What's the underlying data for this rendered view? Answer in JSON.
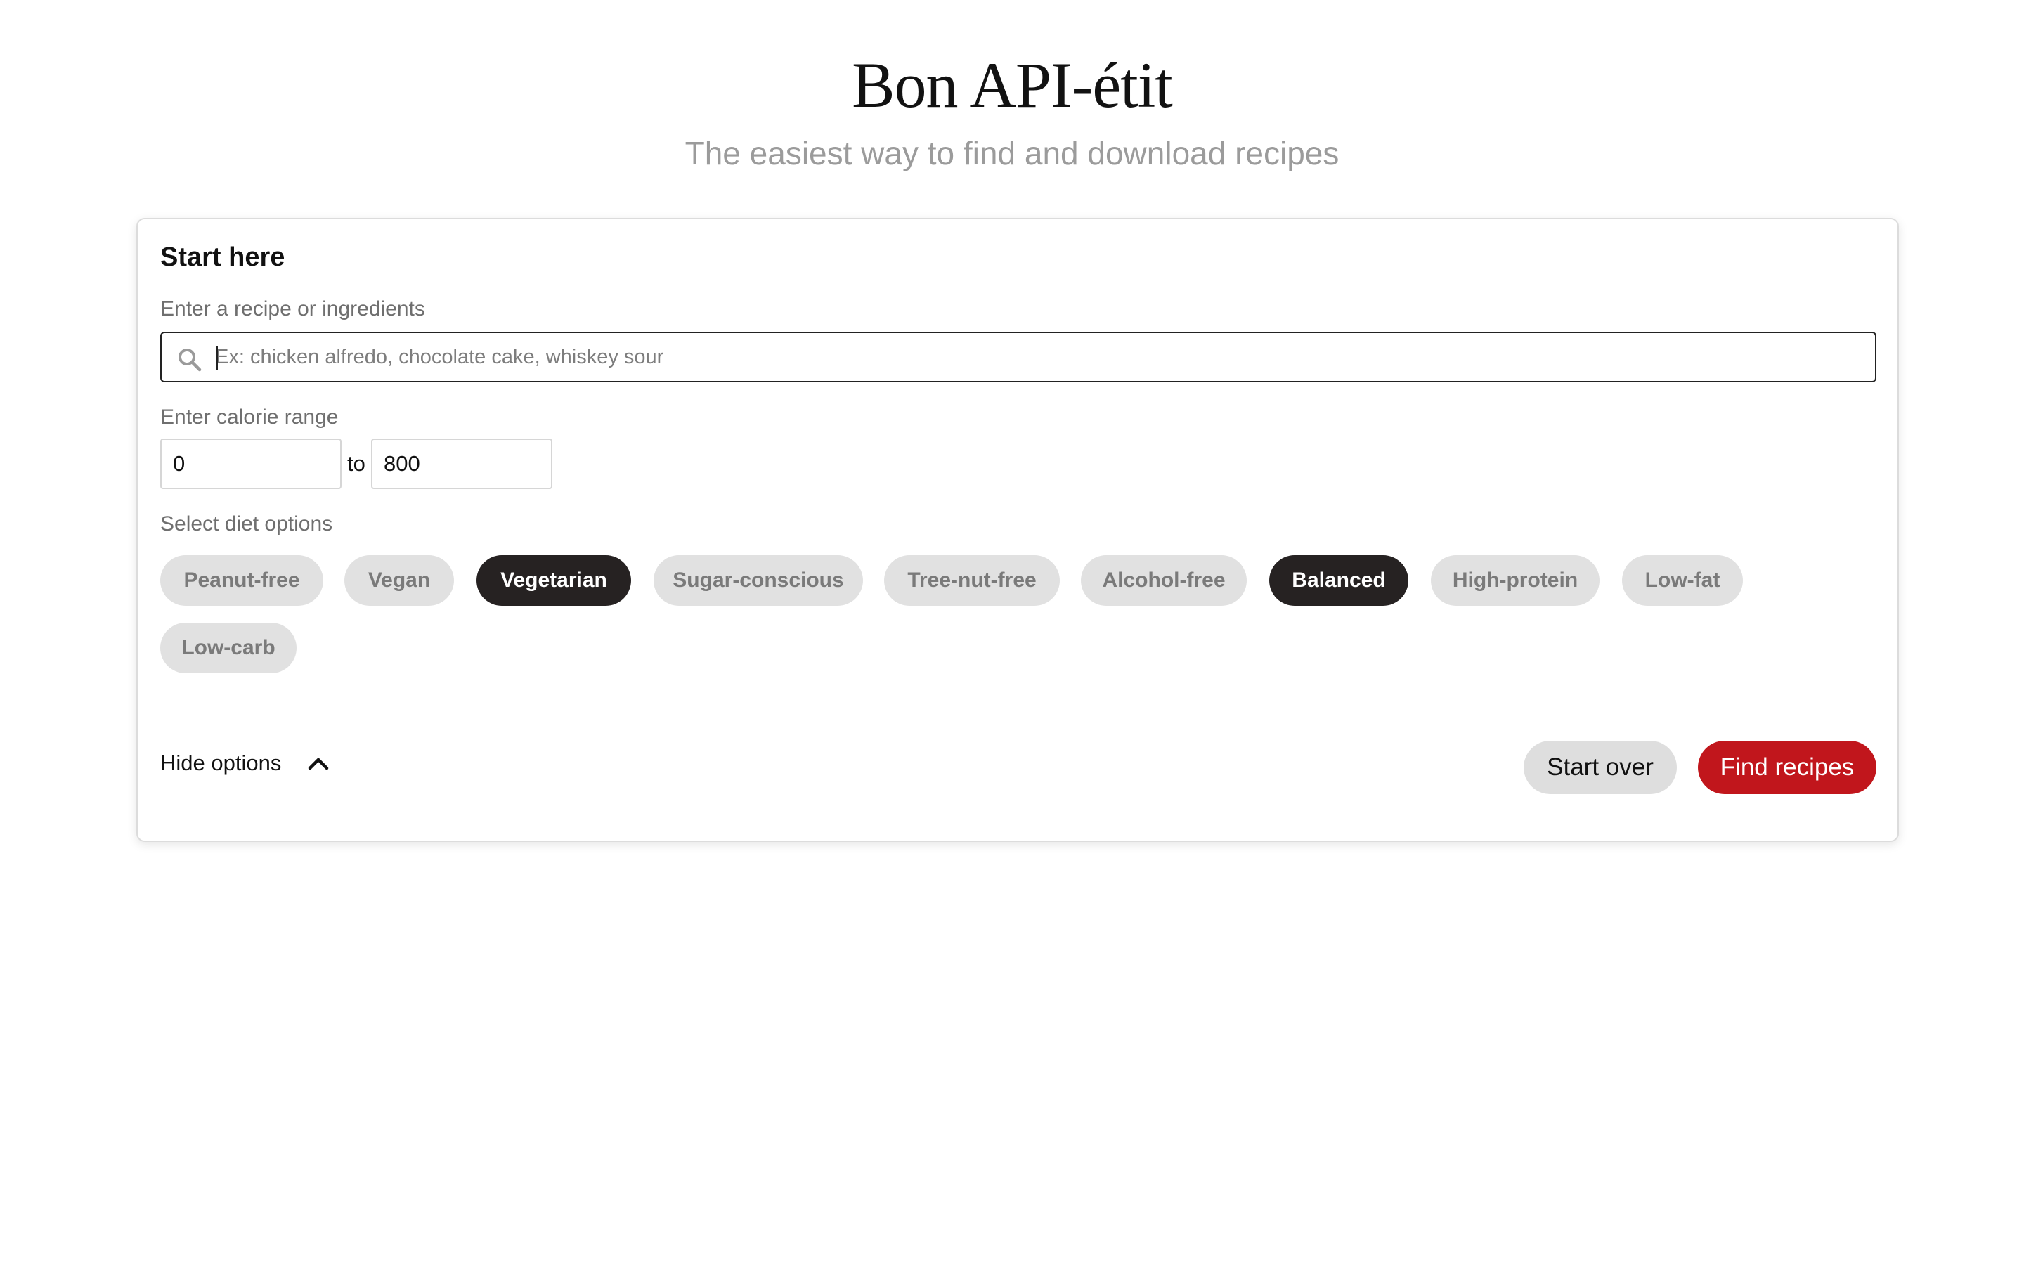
{
  "header": {
    "title": "Bon API-étit",
    "subtitle": "The easiest way to find and download recipes"
  },
  "form": {
    "heading": "Start here",
    "search": {
      "label": "Enter a recipe or ingredients",
      "placeholder": "Ex: chicken alfredo, chocolate cake, whiskey sour",
      "value": ""
    },
    "calories": {
      "label": "Enter calorie range",
      "min": "0",
      "separator": "to",
      "max": "800"
    },
    "diet": {
      "label": "Select diet options",
      "options": [
        {
          "label": "Peanut-free",
          "selected": false
        },
        {
          "label": "Vegan",
          "selected": false
        },
        {
          "label": "Vegetarian",
          "selected": true
        },
        {
          "label": "Sugar-conscious",
          "selected": false
        },
        {
          "label": "Tree-nut-free",
          "selected": false
        },
        {
          "label": "Alcohol-free",
          "selected": false
        },
        {
          "label": "Balanced",
          "selected": true
        },
        {
          "label": "High-protein",
          "selected": false
        },
        {
          "label": "Low-fat",
          "selected": false
        },
        {
          "label": "Low-carb",
          "selected": false
        }
      ]
    },
    "toggle_options_label": "Hide options",
    "start_over_label": "Start over",
    "find_label": "Find recipes"
  },
  "colors": {
    "accent": "#c1161c",
    "chip_selected": "#262222",
    "chip_default": "#e1e1e1"
  },
  "icons": {
    "search": "search-icon",
    "toggle": "chevron-up-icon"
  }
}
